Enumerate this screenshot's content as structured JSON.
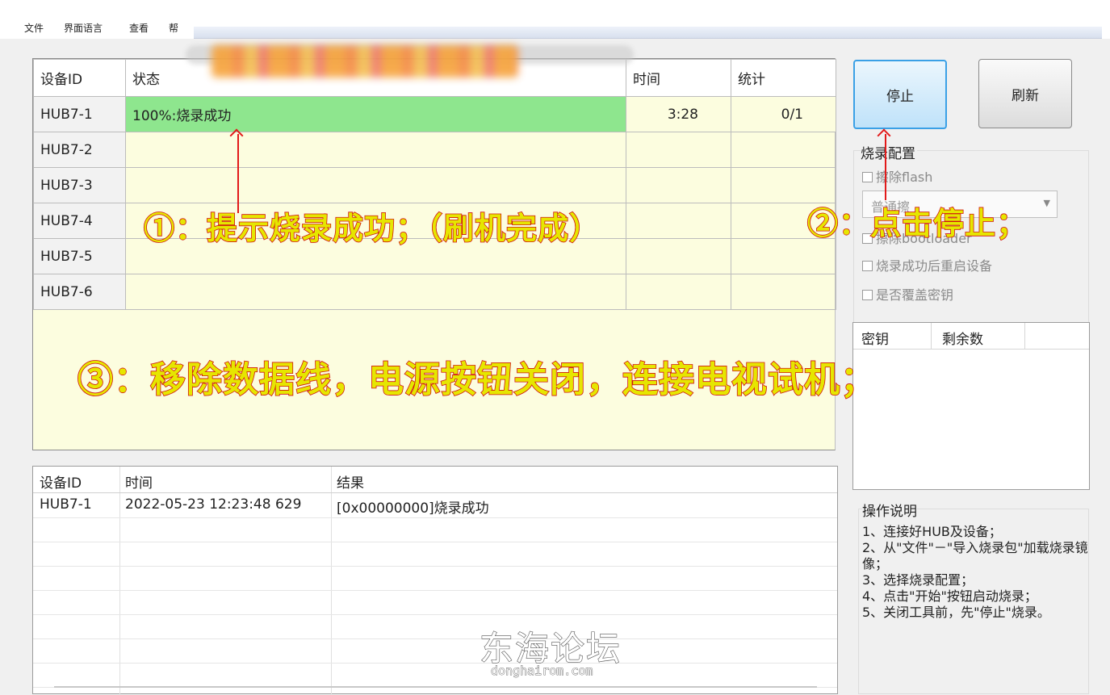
{
  "menu": [
    "文件",
    "界面语言",
    "查看",
    "帮"
  ],
  "device_table": {
    "headers": [
      "设备ID",
      "状态",
      "时间",
      "统计"
    ],
    "rows": [
      {
        "id": "HUB7-1",
        "status": "100%:烧录成功",
        "time": "3:28",
        "count": "0/1"
      },
      {
        "id": "HUB7-2",
        "status": "",
        "time": "",
        "count": ""
      },
      {
        "id": "HUB7-3",
        "status": "",
        "time": "",
        "count": ""
      },
      {
        "id": "HUB7-4",
        "status": "",
        "time": "",
        "count": ""
      },
      {
        "id": "HUB7-5",
        "status": "",
        "time": "",
        "count": ""
      },
      {
        "id": "HUB7-6",
        "status": "",
        "time": "",
        "count": ""
      }
    ]
  },
  "buttons": {
    "stop": "停止",
    "refresh": "刷新"
  },
  "burn_config": {
    "title": "烧录配置",
    "erase_flash": "擦除flash",
    "select_value": "普通擦",
    "erase_bootloader": "擦除bootloader",
    "reboot_after": "烧录成功后重启设备",
    "overwrite_key": "是否覆盖密钥"
  },
  "keys_table": {
    "headers": [
      "密钥",
      "剩余数"
    ]
  },
  "log_table": {
    "headers": [
      "设备ID",
      "时间",
      "结果"
    ],
    "rows": [
      {
        "id": "HUB7-1",
        "time": "2022-05-23 12:23:48 629",
        "result": "[0x00000000]烧录成功"
      }
    ]
  },
  "help": {
    "title": "操作说明",
    "text": "1、连接好HUB及设备；\n2、从\"文件\"－\"导入烧录包\"加载烧录镜像；\n3、选择烧录配置；\n4、点击\"开始\"按钮启动烧录；\n5、关闭工具前，先\"停止\"烧录。"
  },
  "annotations": {
    "a1": "①：提示烧录成功；（刷机完成）",
    "a2": "②：点击停止；",
    "a3": "③：移除数据线，电源按钮关闭，连接电视试机；"
  },
  "watermark": {
    "title": "东海论坛",
    "url": "donghairom.com"
  },
  "colors": {
    "success_green": "#8ee68e",
    "annotation_red": "#e21a1a",
    "annotation_yellow": "#e6e600",
    "table_bg": "#fcfddf"
  }
}
